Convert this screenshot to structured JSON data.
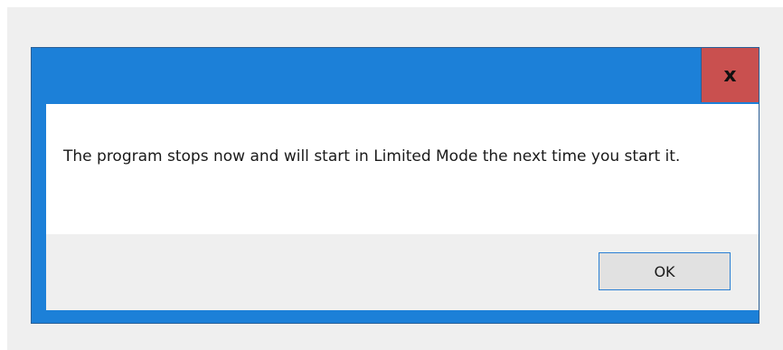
{
  "dialog": {
    "close_label": "x",
    "message": "The program stops now and will start in Limited Mode the next time you start it.",
    "ok_label": "OK"
  },
  "colors": {
    "titlebar": "#1c80d8",
    "close_button": "#c9504f",
    "footer": "#efefef",
    "ok_button_border": "#2a7fd4"
  }
}
